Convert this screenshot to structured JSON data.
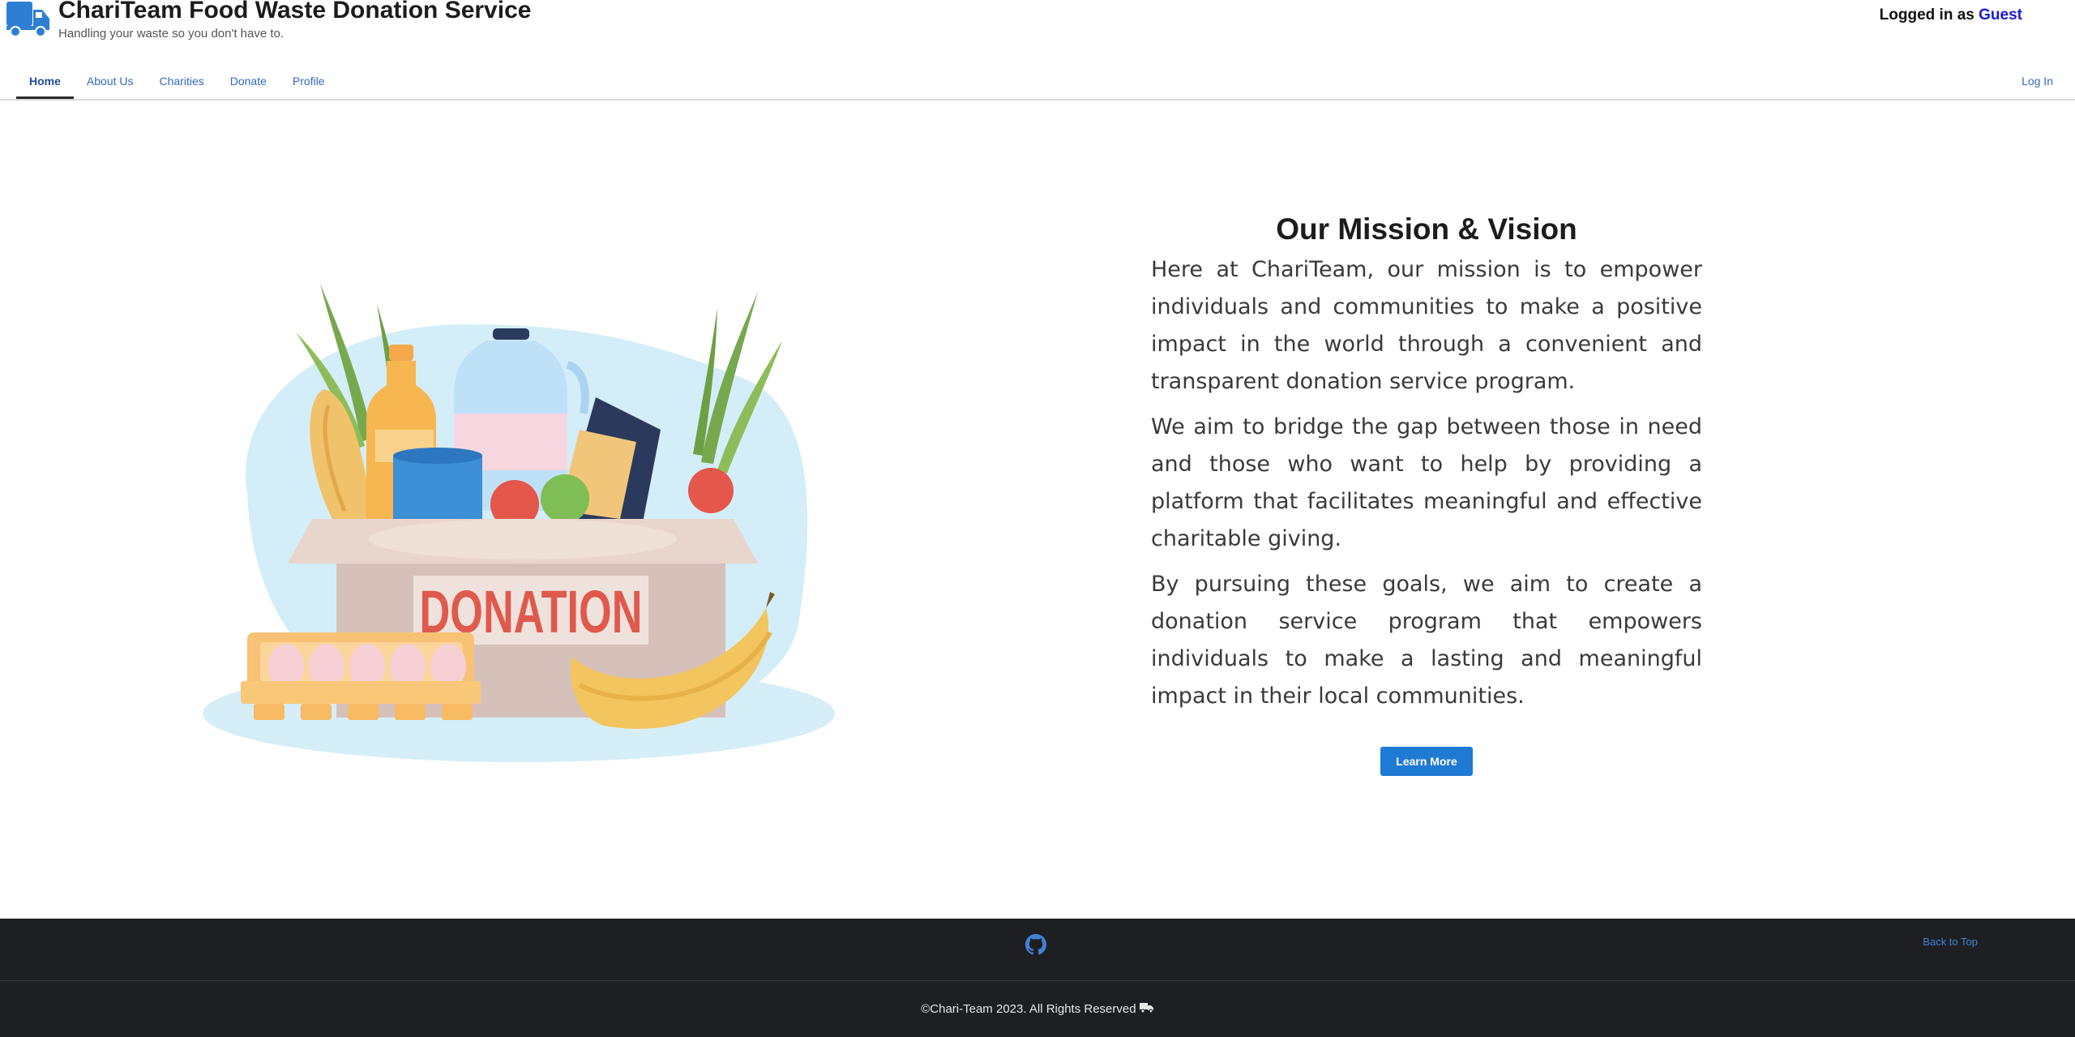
{
  "header": {
    "title": "ChariTeam Food Waste Donation Service",
    "subtitle": "Handling your waste so you don't have to.",
    "login_prefix": "Logged in as",
    "login_user": "Guest",
    "logo_icon": "truck-icon"
  },
  "nav": {
    "items": [
      {
        "label": "Home",
        "active": true
      },
      {
        "label": "About Us",
        "active": false
      },
      {
        "label": "Charities",
        "active": false
      },
      {
        "label": "Donate",
        "active": false
      },
      {
        "label": "Profile",
        "active": false
      }
    ],
    "login_label": "Log In"
  },
  "hero": {
    "illustration_label": "DONATION",
    "title": "Our Mission & Vision",
    "paragraphs": [
      "Here at ChariTeam, our mission is to empower individuals and communities to make a positive impact in the world through a convenient and transparent donation service program.",
      "We aim to bridge the gap between those in need and those who want to help by providing a platform that facilitates meaningful and effective charitable giving.",
      "By pursuing these goals, we aim to create a donation service program that empowers individuals to make a lasting and meaningful impact in their local communities."
    ],
    "button_label": "Learn More"
  },
  "footer": {
    "github_icon": "github-icon",
    "back_to_top": "Back to Top",
    "copyright": "©Chari-Team 2023. All Rights Reserved"
  },
  "colors": {
    "accent": "#1f7ad4",
    "link": "#2f6bbd",
    "footer_bg": "#1e1f23",
    "guest_link": "#1a1ad6"
  }
}
